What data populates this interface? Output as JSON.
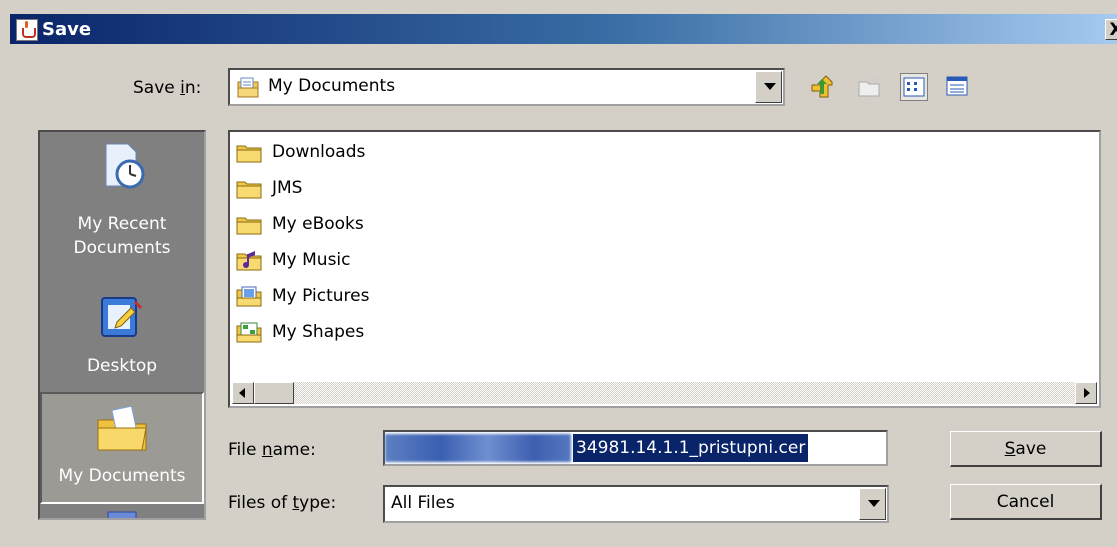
{
  "window": {
    "title": "Save",
    "close_label": "X"
  },
  "save_in": {
    "label_pre": "Save ",
    "label_accel": "i",
    "label_post": "n:",
    "value": "My Documents",
    "value_icon": "my-documents-icon"
  },
  "toolbar": {
    "up_icon": "up-one-level-icon",
    "new_folder_icon": "new-folder-icon",
    "list_icon": "list-view-icon",
    "details_icon": "details-view-icon",
    "active": "list"
  },
  "places": [
    {
      "label_line1": "My Recent",
      "label_line2": "Documents",
      "icon": "recent-documents-icon"
    },
    {
      "label_line1": "Desktop",
      "label_line2": "",
      "icon": "desktop-icon"
    },
    {
      "label_line1": "My Documents",
      "label_line2": "",
      "icon": "my-documents-folder-icon",
      "selected": true
    },
    {
      "label_line1": "",
      "label_line2": "",
      "icon": "my-computer-icon"
    }
  ],
  "files": [
    {
      "name": "Downloads",
      "icon": "folder-icon"
    },
    {
      "name": "JMS",
      "icon": "folder-icon"
    },
    {
      "name": "My eBooks",
      "icon": "folder-icon"
    },
    {
      "name": "My Music",
      "icon": "music-folder-icon"
    },
    {
      "name": "My Pictures",
      "icon": "pictures-folder-icon"
    },
    {
      "name": "My Shapes",
      "icon": "shapes-folder-icon"
    }
  ],
  "file_name": {
    "label_pre": "File ",
    "label_accel": "n",
    "label_post": "ame:",
    "value_visible": "34981.14.1.1_pristupni.cer"
  },
  "file_type": {
    "label_pre": "Files of ",
    "label_accel": "t",
    "label_post": "ype:",
    "value": "All Files"
  },
  "buttons": {
    "save_accel": "S",
    "save_rest": "ave",
    "cancel": "Cancel"
  },
  "colors": {
    "title_start": "#0a246a",
    "title_end": "#a6caf0",
    "dialog_bg": "#d4d0c8",
    "places_bg": "#808080",
    "selection": "#0a246a"
  }
}
